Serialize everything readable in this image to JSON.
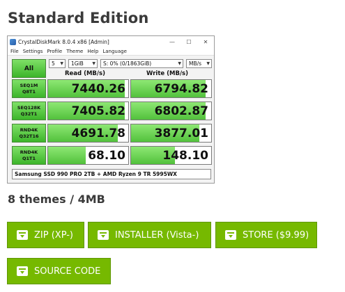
{
  "page": {
    "title": "Standard Edition",
    "themes_text": "8 themes / 4MB"
  },
  "window": {
    "title": "CrystalDiskMark 8.0.4 x86 [Admin]",
    "controls": [
      "—",
      "☐",
      "✕"
    ],
    "menu": [
      "File",
      "Settings",
      "Profile",
      "Theme",
      "Help",
      "Language"
    ]
  },
  "controls": {
    "all_label": "All",
    "count": "5",
    "size": "1GiB",
    "drive": "S: 0% (0/1863GiB)",
    "unit": "MB/s"
  },
  "headers": {
    "read": "Read (MB/s)",
    "write": "Write (MB/s)"
  },
  "rows": [
    {
      "line1": "SEQ1M",
      "line2": "Q8T1",
      "read": "7440.26",
      "write": "6794.82",
      "read_level": 0.96,
      "write_level": 0.93
    },
    {
      "line1": "SEQ128K",
      "line2": "Q32T1",
      "read": "7405.82",
      "write": "6802.87",
      "read_level": 0.96,
      "write_level": 0.93
    },
    {
      "line1": "RND4K",
      "line2": "Q32T16",
      "read": "4691.78",
      "write": "3877.01",
      "read_level": 0.87,
      "write_level": 0.85
    },
    {
      "line1": "RND4K",
      "line2": "Q1T1",
      "read": "68.10",
      "write": "148.10",
      "read_level": 0.47,
      "write_level": 0.55
    }
  ],
  "comment": "Samsung SSD 990 PRO 2TB + AMD Ryzen 9 TR 5995WX",
  "downloads": [
    {
      "label": "ZIP (XP-)",
      "icon": "download-icon"
    },
    {
      "label": "INSTALLER (Vista-)",
      "icon": "download-icon"
    },
    {
      "label": "STORE ($9.99)",
      "icon": "download-icon"
    },
    {
      "label": "SOURCE CODE",
      "icon": "download-icon"
    }
  ],
  "colors": {
    "accent": "#76b900",
    "bar": "#52c13c"
  }
}
